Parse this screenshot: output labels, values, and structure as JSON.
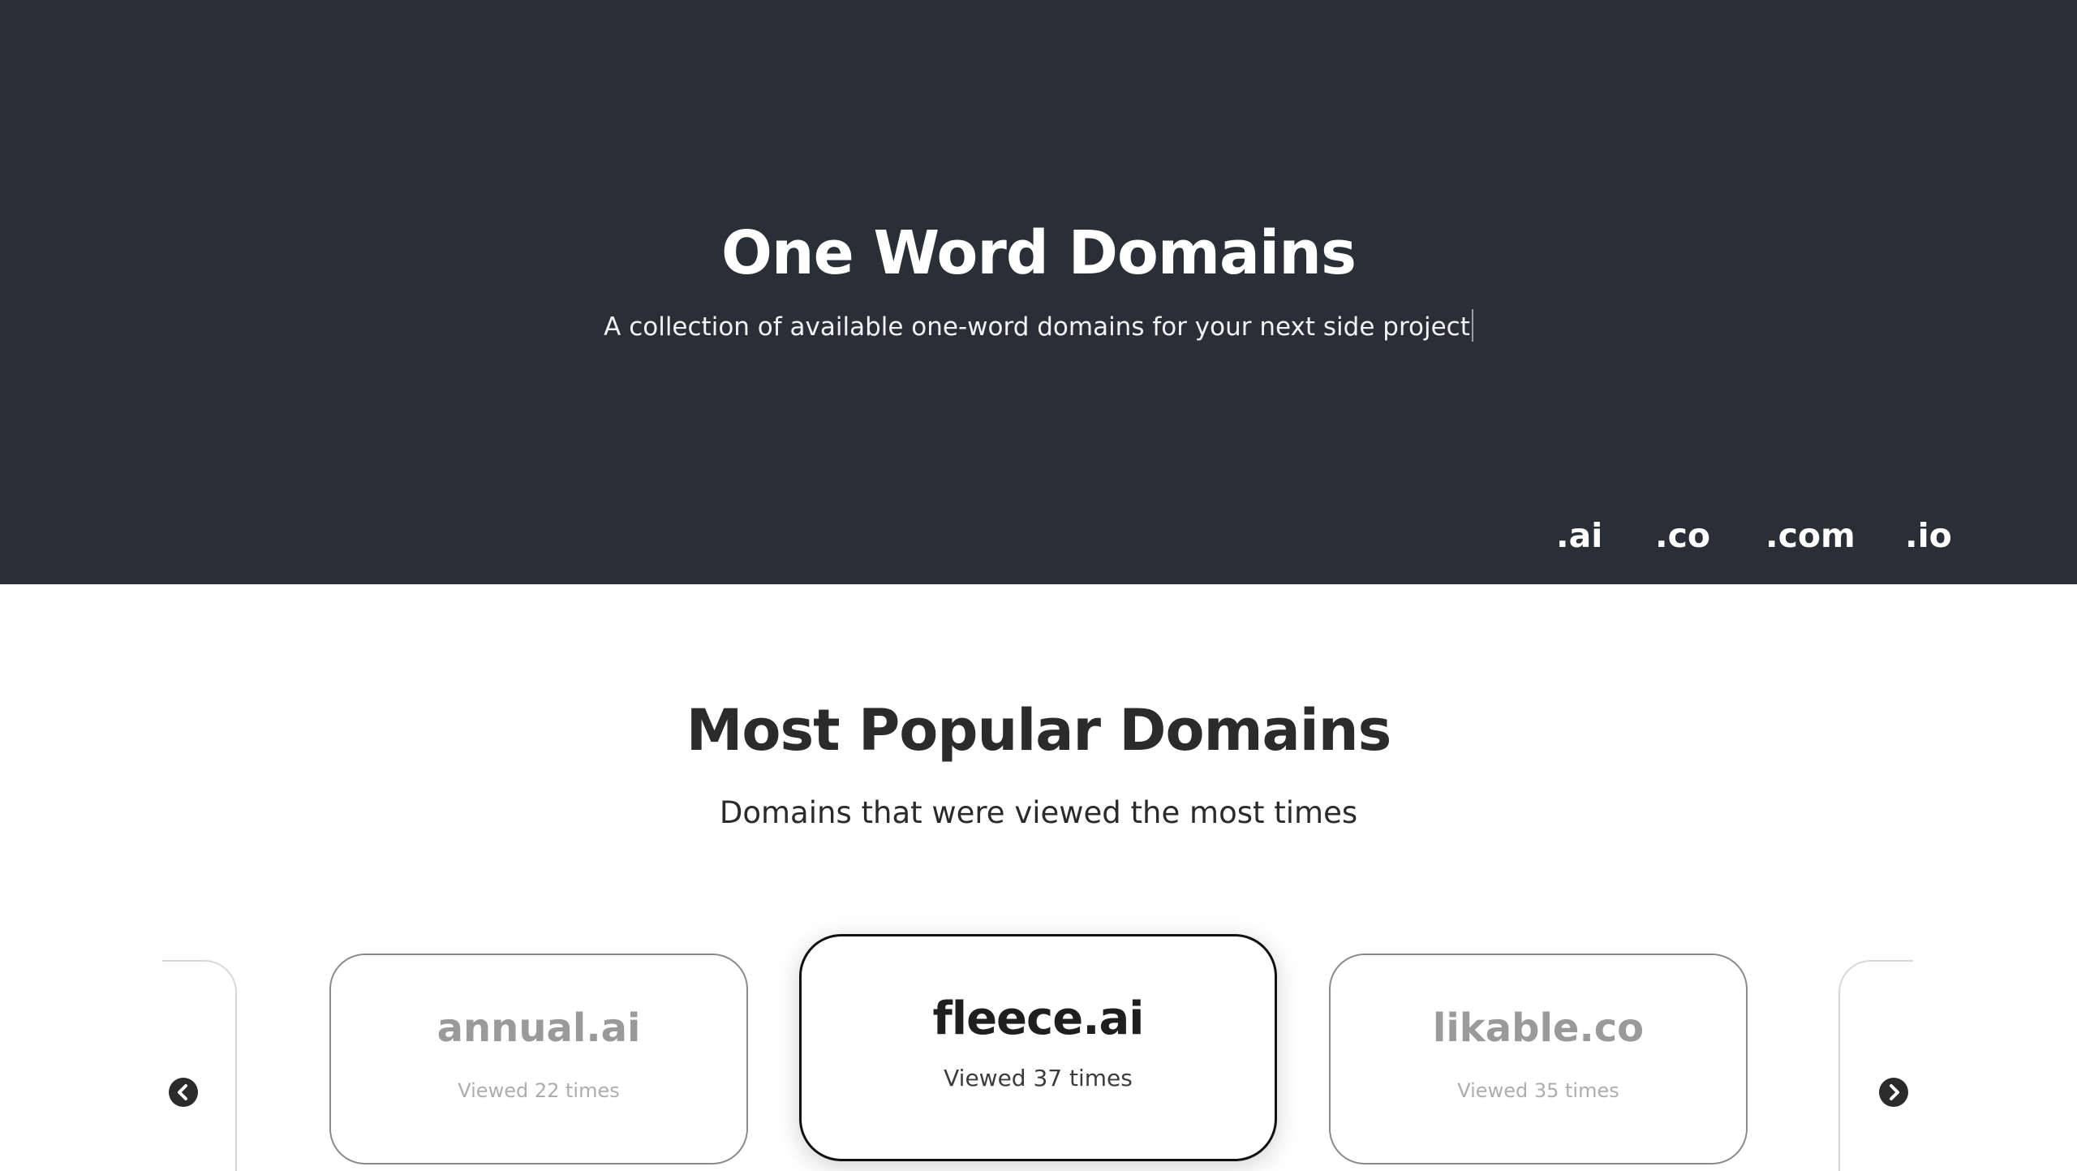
{
  "hero": {
    "title": "One Word Domains",
    "subtitle": "A collection of available one-word domains for your next side project",
    "tld_links": [
      ".ai",
      ".co",
      ".com",
      ".io"
    ]
  },
  "popular": {
    "title": "Most Popular Domains",
    "subtitle": "Domains that were viewed the most times",
    "cards": [
      {
        "domain": "annual.ai",
        "views": "Viewed 22 times"
      },
      {
        "domain": "fleece.ai",
        "views": "Viewed 37 times"
      },
      {
        "domain": "likable.co",
        "views": "Viewed 35 times"
      }
    ]
  },
  "carousel": {
    "prev_icon": "chevron-left-circle-icon",
    "next_icon": "chevron-right-circle-icon"
  },
  "colors": {
    "hero_bg": "#2a2f37",
    "text_dark": "#2b2b2b",
    "card_border": "#8a8a8a",
    "active_card_border": "#111111"
  }
}
